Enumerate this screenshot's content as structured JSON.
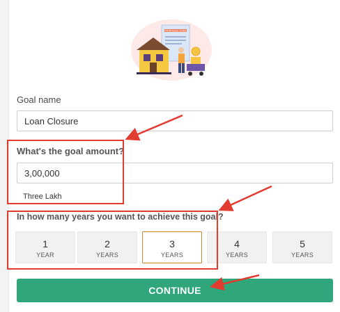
{
  "goal_name": {
    "label": "Goal name",
    "value": "Loan Closure"
  },
  "goal_amount": {
    "label": "What's the goal amount?",
    "value": "3,00,000",
    "in_words": "Three Lakh"
  },
  "years": {
    "label": "In how many years you want to achieve this goal?",
    "selected": "3",
    "options": [
      {
        "num": "1",
        "unit": "YEAR"
      },
      {
        "num": "2",
        "unit": "YEARS"
      },
      {
        "num": "3",
        "unit": "YEARS"
      },
      {
        "num": "4",
        "unit": "YEARS"
      },
      {
        "num": "5",
        "unit": "YEARS"
      }
    ]
  },
  "continue_label": "CONTINUE",
  "colors": {
    "primary_button": "#2fa77b",
    "selected_border": "#d4862a",
    "annotation_red": "#e23b30"
  },
  "illustration": {
    "icon": "house-loan-illustration",
    "sign_text": "MORTGAGE LOAN"
  }
}
